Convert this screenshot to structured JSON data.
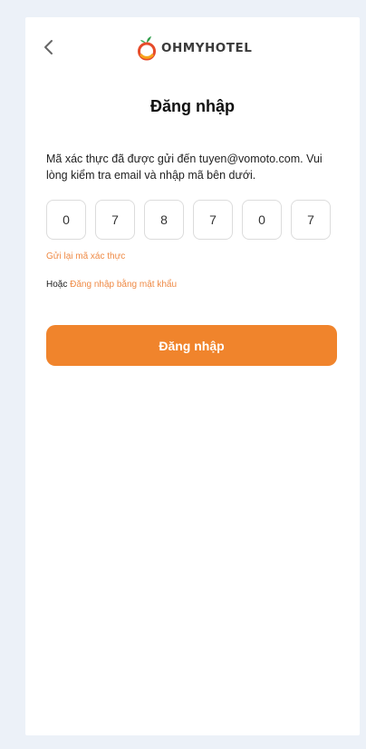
{
  "brand": {
    "logo_text": "OHMYHOTEL",
    "accent_color": "#f0842c",
    "link_color": "#ef8a45"
  },
  "header": {
    "back_icon": "chevron-left-icon"
  },
  "page": {
    "title": "Đăng nhập"
  },
  "message": "Mã xác thực đã được gửi đến tuyen@vomoto.com. Vui lòng kiểm tra email và nhập mã bên dưới.",
  "otp": {
    "digits": [
      "0",
      "7",
      "8",
      "7",
      "0",
      "7"
    ]
  },
  "resend_label": "Gửi lại mã xác thực",
  "alternative": {
    "prefix": "Hoặc",
    "link_label": "Đăng nhập bằng mật khẩu"
  },
  "login_button_label": "Đăng nhập"
}
